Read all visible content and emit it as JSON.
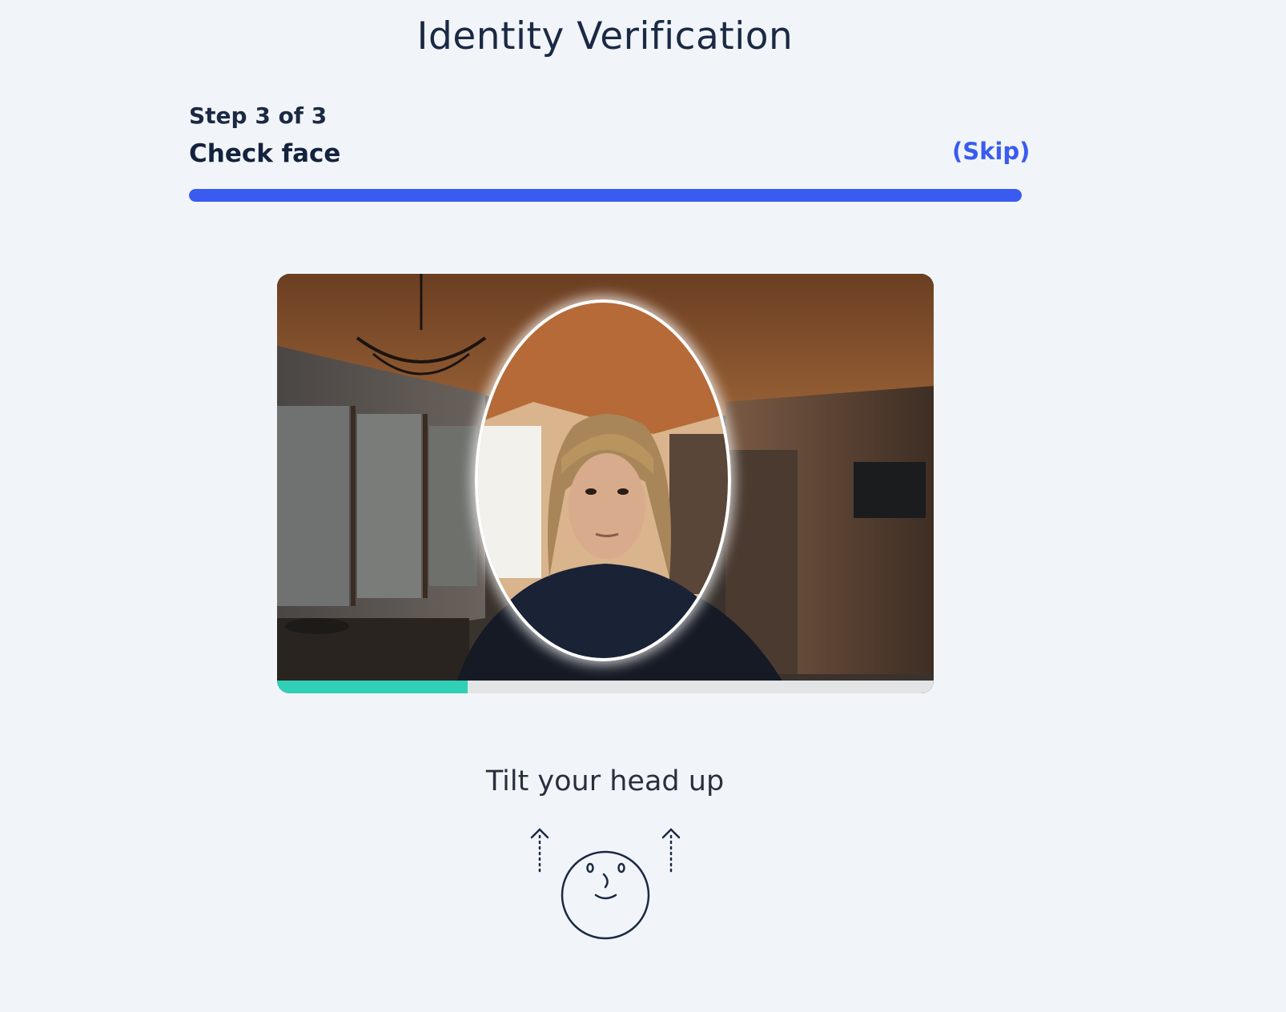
{
  "header": {
    "title": "Identity Verification"
  },
  "step": {
    "label": "Step 3 of 3",
    "title": "Check face",
    "skip_label": "(Skip)",
    "progress_fraction": 1.0
  },
  "camera": {
    "capture_progress_fraction": 0.29
  },
  "instruction": {
    "text": "Tilt your head up"
  },
  "icons": {
    "illustration": "face-tilt-up-icon",
    "arrows": "arrow-up-icon"
  },
  "colors": {
    "accent": "#3a5bf0",
    "capture_progress": "#2fd0b5",
    "text_dark": "#1b2944",
    "background": "#f1f5f9"
  }
}
